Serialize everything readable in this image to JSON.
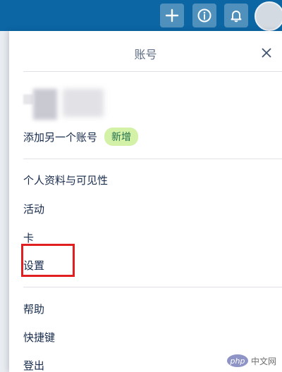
{
  "topbar": {
    "icons": [
      "plus-icon",
      "info-icon",
      "bell-icon",
      "avatar"
    ]
  },
  "account_panel": {
    "title": "账号",
    "add_account_label": "添加另一个账号",
    "new_badge": "新增",
    "menu": [
      {
        "label": "个人资料与可见性"
      },
      {
        "label": "活动"
      },
      {
        "label": "卡"
      },
      {
        "label": "设置"
      },
      {
        "label": "帮助"
      },
      {
        "label": "快捷键"
      },
      {
        "label": "登出"
      }
    ]
  },
  "watermark": {
    "logo": "php",
    "text": "中文网"
  },
  "colors": {
    "topbar": "#0c66a4",
    "highlight": "#e02020",
    "badge_bg": "#d3f1a7",
    "badge_text": "#216e4e"
  }
}
